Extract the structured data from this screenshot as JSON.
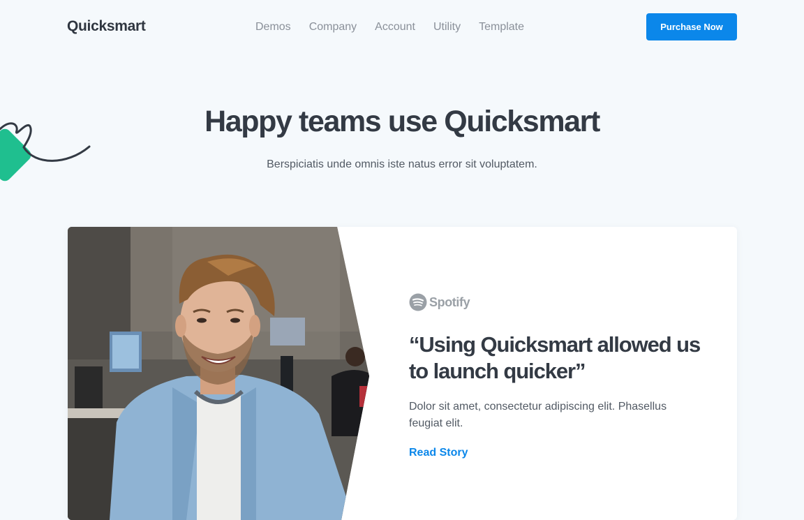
{
  "header": {
    "logo": "Quicksmart",
    "nav": [
      "Demos",
      "Company",
      "Account",
      "Utility",
      "Template"
    ],
    "cta_label": "Purchase Now"
  },
  "hero": {
    "title": "Happy teams use Quicksmart",
    "subtitle": "Berspiciatis unde omnis iste natus error sit voluptatem."
  },
  "testimonial": {
    "brand": "Spotify",
    "quote": "“Using Quicksmart allowed us to launch quicker”",
    "text": "Dolor sit amet, consectetur adipiscing elit. Phasellus feugiat elit.",
    "link_label": "Read Story"
  },
  "colors": {
    "background": "#f5f9fc",
    "accent": "#0b87ea",
    "decor_green": "#1fbf8f",
    "heading": "#333a44"
  },
  "icons": {
    "brand_logo": "spotify-icon",
    "decoration": "squiggle-shape"
  }
}
